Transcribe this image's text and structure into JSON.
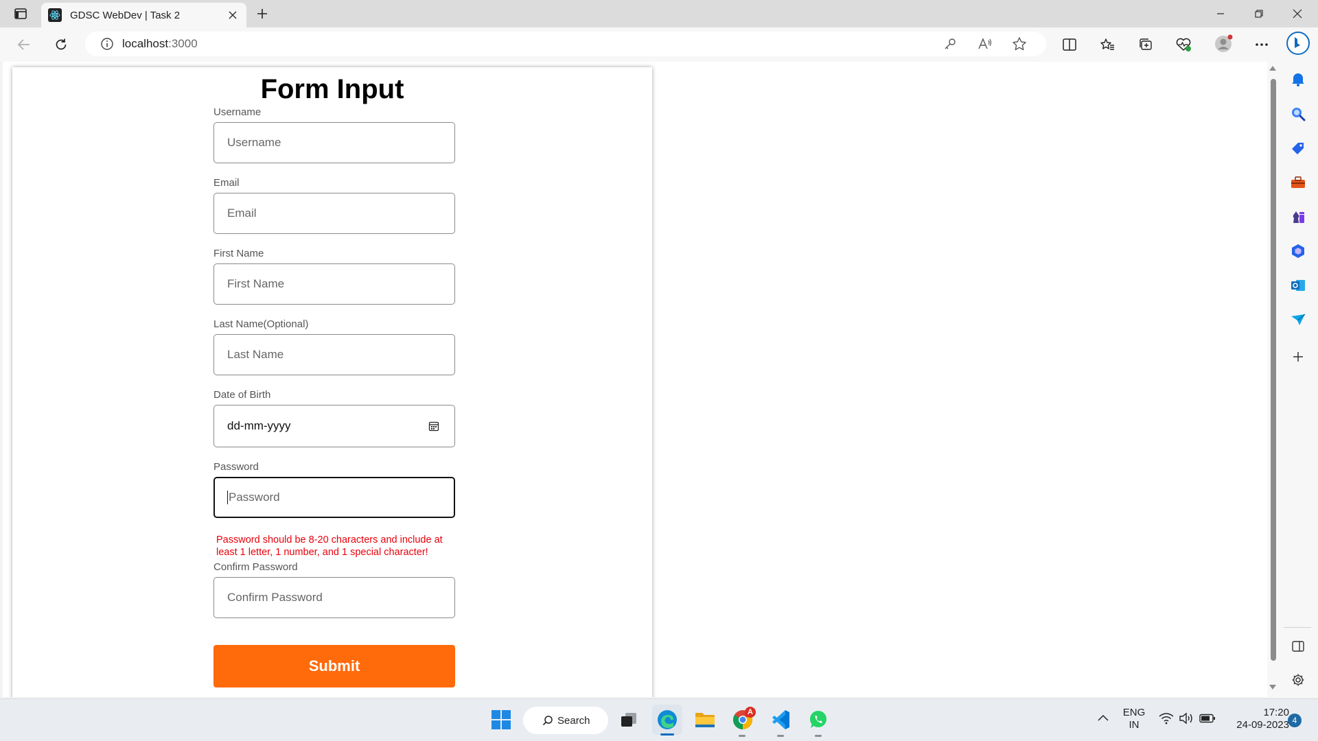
{
  "browser": {
    "tab_title": "GDSC WebDev | Task 2",
    "url_host": "localhost",
    "url_port": ":3000"
  },
  "form": {
    "title": "Form Input",
    "fields": [
      {
        "label": "Username",
        "placeholder": "Username"
      },
      {
        "label": "Email",
        "placeholder": "Email"
      },
      {
        "label": "First Name",
        "placeholder": "First Name"
      },
      {
        "label": "Last Name(Optional)",
        "placeholder": "Last Name"
      },
      {
        "label": "Date of Birth",
        "placeholder": "dd-mm-yyyy"
      },
      {
        "label": "Password",
        "placeholder": "Password"
      },
      {
        "label": "Confirm Password",
        "placeholder": "Confirm Password"
      }
    ],
    "password_error": "Password should be 8-20 characters and include at least 1 letter, 1 number, and 1 special character!",
    "submit_label": "Submit"
  },
  "taskbar": {
    "search_label": "Search",
    "lang_line1": "ENG",
    "lang_line2": "IN",
    "time": "17:20",
    "date": "24-09-2023",
    "notification_count": "4",
    "chrome_badge": "A"
  },
  "colors": {
    "submit": "#ff6a0a",
    "error": "#e8000b",
    "edge_accent": "#0f6cbd"
  }
}
